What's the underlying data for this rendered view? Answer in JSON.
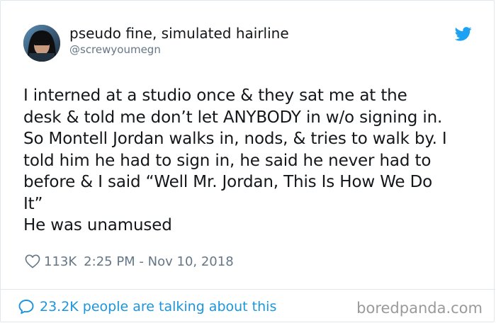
{
  "user": {
    "display_name": "pseudo fine, simulated hairline",
    "handle": "@screwyoumegn",
    "avatar_icon": "user-avatar"
  },
  "brand": {
    "icon": "twitter-bird-icon",
    "color": "#1da1f2"
  },
  "tweet": {
    "text": "I interned at a studio once & they sat me at the\ndesk & told me don’t let ANYBODY in w/o signing in.\nSo Montell Jordan walks in, nods, & tries to walk by. I\ntold him he had to sign in, he said he never had to\nbefore & I said “Well Mr. Jordan, This Is How We Do\nIt”\nHe was unamused",
    "likes": "113K",
    "timestamp": "2:25 PM - Nov 10, 2018"
  },
  "footer": {
    "conversation_text": "23.2K people are talking about this",
    "icon": "comment-bubble-icon",
    "link_color": "#1b95e0"
  },
  "watermark": {
    "text": "boredpanda.com"
  }
}
